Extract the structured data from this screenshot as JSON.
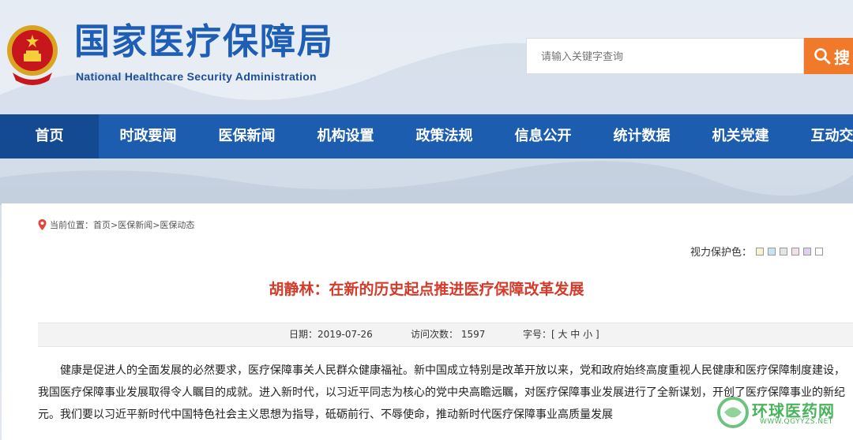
{
  "header": {
    "site_title": "国家医疗保障局",
    "site_subtitle": "National Healthcare Security Administration",
    "emblem_icon": "national-emblem-icon",
    "search_placeholder": "请输入关键字查询",
    "search_button_label": "搜"
  },
  "nav": {
    "items": [
      "首页",
      "时政要闻",
      "医保新闻",
      "机构设置",
      "政策法规",
      "信息公开",
      "统计数据",
      "机关党建",
      "互动交流"
    ],
    "active_index": 0
  },
  "breadcrumb": {
    "text": "当前位置：首页>医保新闻>医保动态"
  },
  "vision": {
    "label": "视力保护色：",
    "swatches": [
      "#f7f3cf",
      "#c8e4f4",
      "#e4e4e4",
      "#f2dfe8",
      "#ddd1ee",
      "#ffffff"
    ]
  },
  "article": {
    "title": "胡静林：在新的历史起点推进医疗保障改革发展",
    "date": "日期：2019-07-26",
    "visits": "访问次数： 1597",
    "font_size": "字号：[ 大 中 小 ]",
    "paragraph": "健康是促进人的全面发展的必然要求，医疗保障事关人民群众健康福祉。新中国成立特别是改革开放以来，党和政府始终高度重视人民健康和医疗保障制度建设，我国医疗保障事业发展取得令人瞩目的成就。进入新时代，以习近平同志为核心的党中央高瞻远瞩，对医疗保障事业发展进行了全新谋划，开创了医疗保障事业的新纪元。我们要以习近平新时代中国特色社会主义思想为指导，砥砺前行、不辱使命，推动新时代医疗保障事业高质量发展"
  },
  "watermark": {
    "name": "环球医药网",
    "url": "WWW.QGYYZS.NET"
  },
  "colors": {
    "brand_blue": "#1d5db0",
    "title_red": "#d43b2a",
    "search_orange": "#f07a2a"
  }
}
